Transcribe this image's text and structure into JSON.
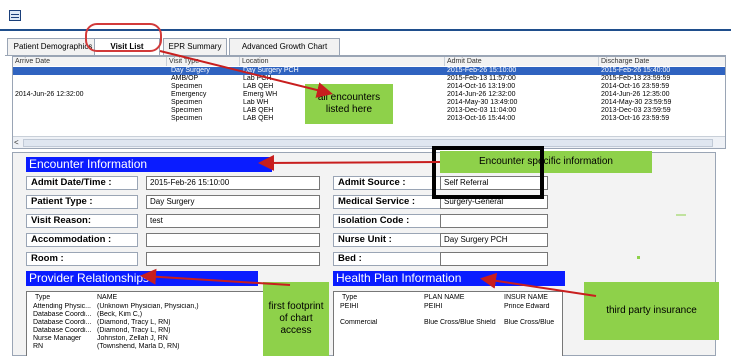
{
  "window": {
    "icon": "app-icon"
  },
  "tabs": [
    {
      "label": "Patient Demographics"
    },
    {
      "label": "Visit List"
    },
    {
      "label": "EPR Summary"
    },
    {
      "label": "Advanced Growth Chart"
    }
  ],
  "visit_grid": {
    "columns": [
      "Arrive Date",
      "Visit Type",
      "Location",
      "Admit Date",
      "Discharge Date"
    ],
    "rows": [
      {
        "arrive": "",
        "type": "Day Surgery",
        "location": "Day Surgery PCH",
        "admit": "2015-Feb-26 15:10:00",
        "discharge": "2015-Feb-26 15:40:00",
        "selected": true
      },
      {
        "arrive": "",
        "type": "AMB/OP",
        "location": "Lab PCH",
        "admit": "2015-Feb-13 11:57:00",
        "discharge": "2015-Feb-13 23:59:59"
      },
      {
        "arrive": "",
        "type": "Specimen",
        "location": "LAB QEH",
        "admit": "2014-Oct-16 13:19:00",
        "discharge": "2014-Oct-16 23:59:59"
      },
      {
        "arrive": "2014-Jun-26 12:32:00",
        "type": "Emergency",
        "location": "Emerg WH",
        "admit": "2014-Jun-26 12:32:00",
        "discharge": "2014-Jun-26 12:35:00"
      },
      {
        "arrive": "",
        "type": "Specimen",
        "location": "Lab WH",
        "admit": "2014-May-30 13:49:00",
        "discharge": "2014-May-30 23:59:59"
      },
      {
        "arrive": "",
        "type": "Specimen",
        "location": "LAB QEH",
        "admit": "2013-Dec-03 11:04:00",
        "discharge": "2013-Dec-03 23:59:59"
      },
      {
        "arrive": "",
        "type": "Specimen",
        "location": "LAB QEH",
        "admit": "2013-Oct-16 15:44:00",
        "discharge": "2013-Oct-16 23:59:59"
      }
    ],
    "scroll_left": "<"
  },
  "encounter": {
    "header": "Encounter Information",
    "admit_datetime_label": "Admit Date/Time :",
    "admit_datetime_value": "2015-Feb-26 15:10:00",
    "patient_type_label": "Patient Type :",
    "patient_type_value": "Day Surgery",
    "visit_reason_label": "Visit Reason:",
    "visit_reason_value": "test",
    "accommodation_label": "Accommodation :",
    "accommodation_value": "",
    "room_label": "Room :",
    "room_value": "",
    "admit_source_label": "Admit Source :",
    "admit_source_value": "Self Referral",
    "medical_service_label": "Medical Service :",
    "medical_service_value": "Surgery-General",
    "isolation_code_label": "Isolation Code :",
    "isolation_code_value": "",
    "nurse_unit_label": "Nurse Unit :",
    "nurse_unit_value": "Day Surgery PCH",
    "bed_label": "Bed :",
    "bed_value": ""
  },
  "providers": {
    "header": "Provider Relationships",
    "columns": [
      "Type",
      "NAME"
    ],
    "rows": [
      {
        "type": "Attending Physic...",
        "name": "(Unknown Physician, Physician,)"
      },
      {
        "type": "Database Coordi...",
        "name": "(Beck, Kim C,)"
      },
      {
        "type": "Database Coordi...",
        "name": "(Diamond, Tracy L, RN)"
      },
      {
        "type": "Database Coordi...",
        "name": "(Diamond, Tracy L, RN)"
      },
      {
        "type": "Nurse Manager",
        "name": "Johnston, Zellah J, RN"
      },
      {
        "type": "RN",
        "name": "(Townshend, Marla D, RN)"
      }
    ]
  },
  "health_plan": {
    "header": "Health Plan Information",
    "columns": [
      "Type",
      "PLAN NAME",
      "INSUR NAME"
    ],
    "rows": [
      {
        "type": "PEIHI",
        "plan": "PEIHI",
        "insurer": "Prince Edward"
      },
      {
        "type": "Commercial",
        "plan": "Blue Cross/Blue Shield",
        "insurer": "Blue Cross/Blue"
      }
    ]
  },
  "annotations": {
    "all_encounters": "all encounters listed here",
    "encounter_specific": "Encounter specific information",
    "first_footprint": "first footprint of chart access",
    "third_party": "third party insurance"
  },
  "colors": {
    "section_header": "#0a1cff",
    "callout": "#8ed14a",
    "arrow": "#c81e1e",
    "selected_row": "#2f63c0"
  }
}
